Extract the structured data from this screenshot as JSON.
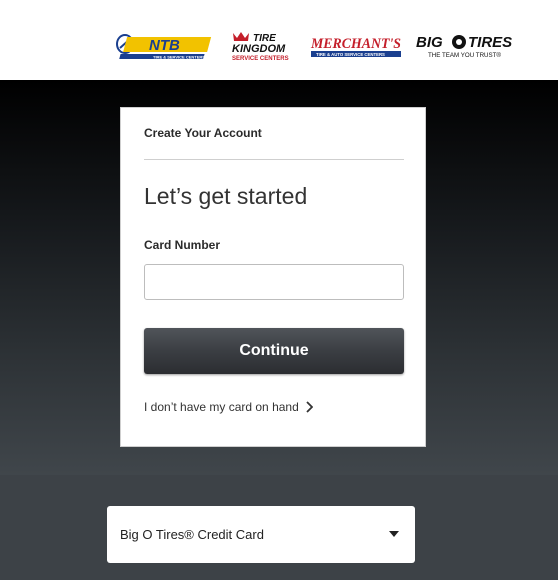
{
  "brands": {
    "ntb": {
      "name": "NTB",
      "tagline": "TIRE & SERVICE CENTERS",
      "color_primary": "#1a3f8f",
      "color_accent": "#f2c200"
    },
    "tire_kingdom": {
      "line1": "TIRE",
      "line2": "KINGDOM",
      "tagline": "SERVICE CENTERS",
      "color": "#c41e2a"
    },
    "merchants": {
      "name": "MERCHANT'S",
      "tagline": "TIRE & AUTO SERVICE CENTERS",
      "color": "#c41e2a"
    },
    "big_o": {
      "name_left": "BIG",
      "name_right": "TIRES",
      "tagline": "THE TEAM YOU TRUST®",
      "color": "#111111"
    }
  },
  "card": {
    "header": "Create Your Account",
    "headline": "Let’s get started",
    "field_label": "Card Number",
    "field_value": "",
    "field_placeholder": "",
    "continue_label": "Continue",
    "no_card_link": "I don’t have my card on hand"
  },
  "card_type_select": {
    "selected": "Big O Tires® Credit Card"
  }
}
